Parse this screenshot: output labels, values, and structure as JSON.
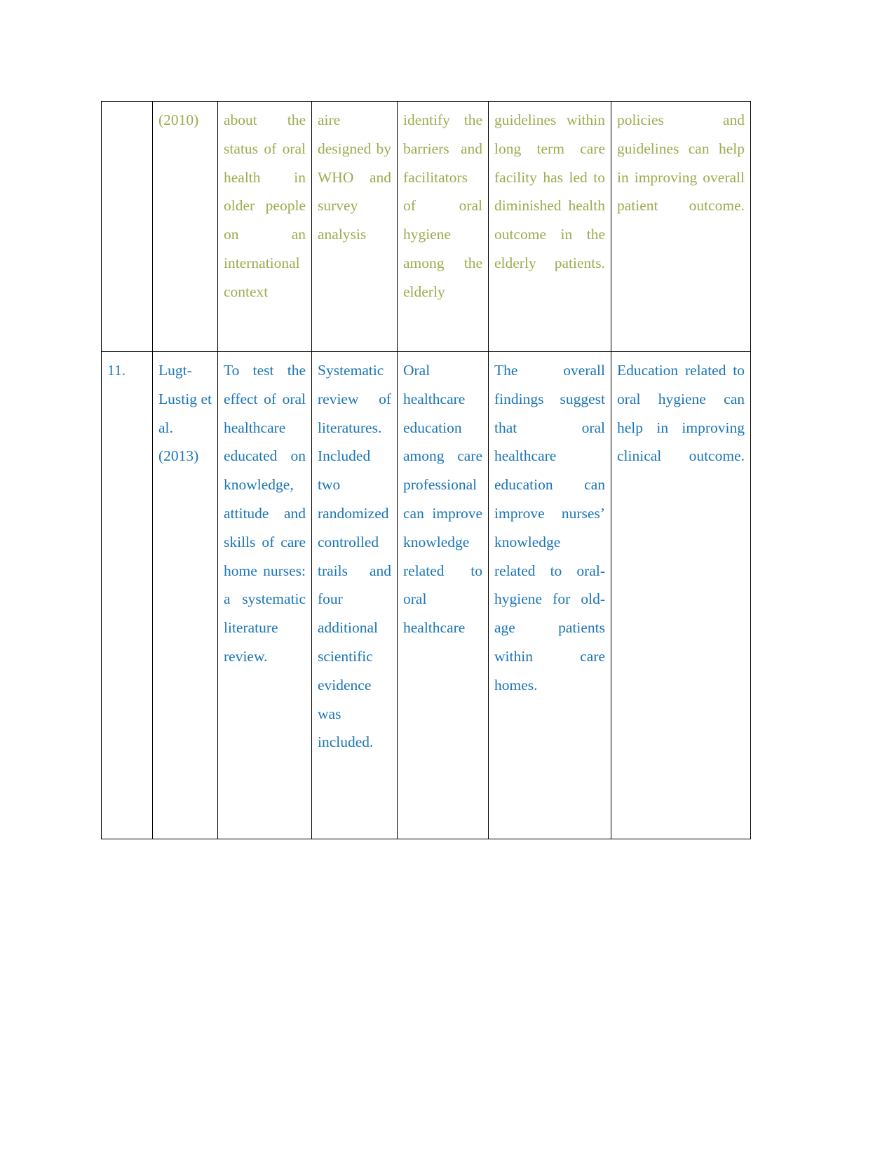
{
  "document": {
    "type": "literature-review-table",
    "page_background": "#ffffff",
    "border_color": "#000000",
    "row_colors": {
      "row_1_text": "#9aad4f",
      "row_2_text": "#1b75b4"
    }
  },
  "table": {
    "columns": 7,
    "rows": [
      {
        "id": "row-continued",
        "color": "#9aad4f",
        "cells": {
          "serial_no": "",
          "author_year": "(2010)",
          "aim": "about the status of oral health in older people on an international context",
          "methodology": "aire designed by WHO and survey analysis",
          "key_findings": "identify the barriers and facilitators of oral hygiene among the elderly",
          "discussion": "guidelines within long term care facility has led to diminished health outcome in the elderly patients.",
          "conclusion": "policies and guidelines can help in improving overall patient outcome."
        }
      },
      {
        "id": "row-11",
        "color": "#1b75b4",
        "cells": {
          "serial_no": "11.",
          "author_year": "Lugt-Lustig et al. (2013)",
          "aim": "To test the effect of oral healthcare educated on knowledge, attitude and skills of care home nurses: a systematic literature review.",
          "methodology": "Systematic review of literatures. Included two randomized controlled trails and four additional scientific evidence was included.",
          "key_findings": "Oral healthcare education among care professional can improve knowledge related to oral healthcare",
          "discussion": "The overall findings suggest that oral healthcare education can improve nurses’ knowledge related to oral-hygiene for old-age patients within care homes.",
          "conclusion": "Education related to oral hygiene can help in improving clinical outcome."
        }
      }
    ]
  }
}
